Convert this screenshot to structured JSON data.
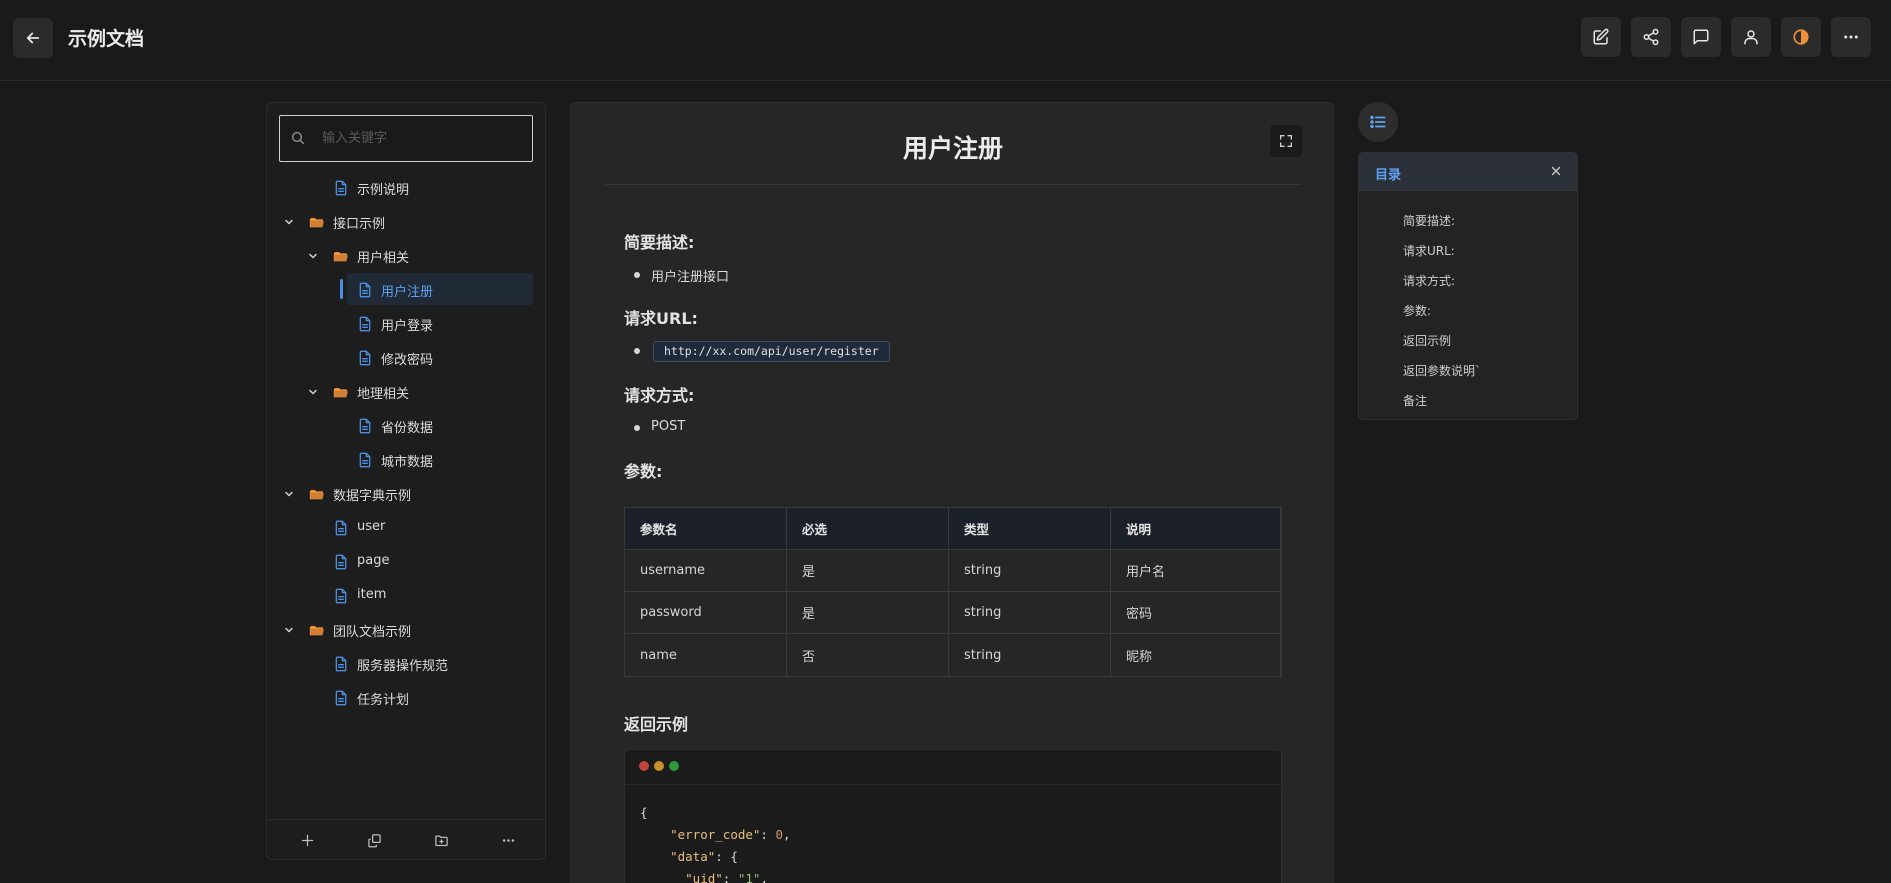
{
  "header": {
    "title": "示例文档",
    "toolbar_icons": [
      "edit-icon",
      "share-icon",
      "comment-icon",
      "user-icon",
      "theme-icon",
      "more-icon"
    ],
    "theme_accent": "#f0913a"
  },
  "sidebar": {
    "search_placeholder": "输入关键字",
    "tree": [
      {
        "label": "示例说明",
        "type": "doc",
        "depth": 1
      },
      {
        "label": "接口示例",
        "type": "folder",
        "depth": 0,
        "expanded": true
      },
      {
        "label": "用户相关",
        "type": "folder",
        "depth": 1,
        "expanded": true
      },
      {
        "label": "用户注册",
        "type": "doc",
        "depth": 2,
        "active": true
      },
      {
        "label": "用户登录",
        "type": "doc",
        "depth": 2
      },
      {
        "label": "修改密码",
        "type": "doc",
        "depth": 2
      },
      {
        "label": "地理相关",
        "type": "folder",
        "depth": 1,
        "expanded": true
      },
      {
        "label": "省份数据",
        "type": "doc",
        "depth": 2
      },
      {
        "label": "城市数据",
        "type": "doc",
        "depth": 2
      },
      {
        "label": "数据字典示例",
        "type": "folder",
        "depth": 0,
        "expanded": true
      },
      {
        "label": "user",
        "type": "doc",
        "depth": 1
      },
      {
        "label": "page",
        "type": "doc",
        "depth": 1
      },
      {
        "label": "item",
        "type": "doc",
        "depth": 1
      },
      {
        "label": "团队文档示例",
        "type": "folder",
        "depth": 0,
        "expanded": true
      },
      {
        "label": "服务器操作规范",
        "type": "doc",
        "depth": 1
      },
      {
        "label": "任务计划",
        "type": "doc",
        "depth": 1
      }
    ],
    "footer_icons": [
      "add-icon",
      "copy-icon",
      "new-folder-icon",
      "more-icon"
    ]
  },
  "content": {
    "title": "用户注册",
    "sections": {
      "desc_heading": "简要描述:",
      "desc_item": "用户注册接口",
      "url_heading": "请求URL:",
      "url_value": "http://xx.com/api/user/register",
      "method_heading": "请求方式:",
      "method_value": "POST",
      "params_heading": "参数:",
      "return_heading": "返回示例"
    },
    "params_table": {
      "headers": [
        "参数名",
        "必选",
        "类型",
        "说明"
      ],
      "rows": [
        [
          "username",
          "是",
          "string",
          "用户名"
        ],
        [
          "password",
          "是",
          "string",
          "密码"
        ],
        [
          "name",
          "否",
          "string",
          "昵称"
        ]
      ]
    },
    "code_lines": [
      {
        "text": "{"
      },
      {
        "key": "\"error_code\"",
        "sep": ": ",
        "num": "0",
        "tail": ","
      },
      {
        "key": "\"data\"",
        "sep": ": ",
        "tail": "{"
      },
      {
        "key": "\"uid\"",
        "sep": ": ",
        "str": "\"1\"",
        "tail": ","
      }
    ]
  },
  "toc": {
    "title": "目录",
    "items": [
      "简要描述:",
      "请求URL:",
      "请求方式:",
      "参数:",
      "返回示例",
      "返回参数说明`",
      "备注"
    ]
  },
  "colors": {
    "accent_blue": "#5ea2f2",
    "folder_orange": "#f0913a",
    "doc_blue": "#4a8fe0",
    "dot_red": "#e0443e",
    "dot_yellow": "#dea123",
    "dot_green": "#1aab29"
  }
}
